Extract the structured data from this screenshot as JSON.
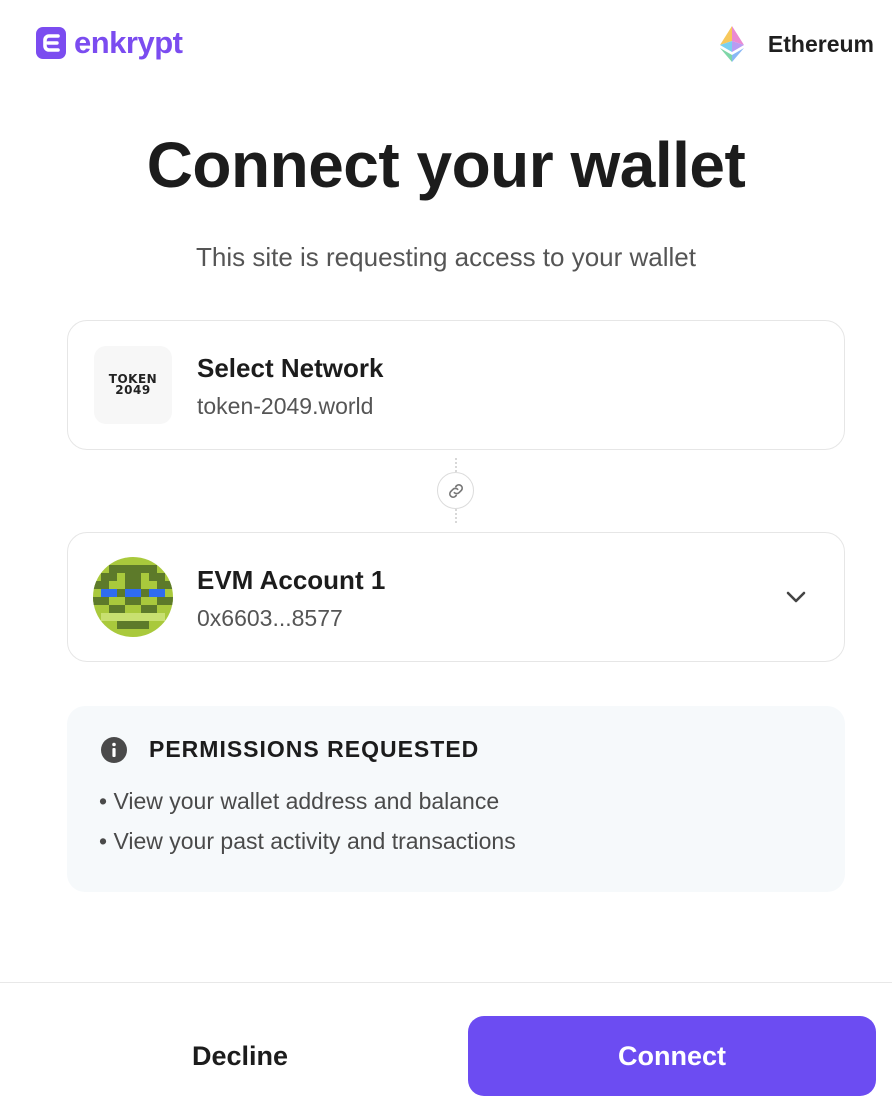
{
  "header": {
    "brand_name": "enkrypt",
    "brand_icon": "enkrypt-logo",
    "network_icon": "ethereum-icon",
    "network_name": "Ethereum"
  },
  "main": {
    "title": "Connect your wallet",
    "subtitle": "This site is requesting access to your wallet"
  },
  "site": {
    "logo_text_line1": "TOKEN",
    "logo_text_line2": "2049",
    "title": "Select Network",
    "domain": "token-2049.world"
  },
  "connector": {
    "icon": "link-icon"
  },
  "account": {
    "name": "EVM Account 1",
    "address": "0x6603...8577",
    "avatar_icon": "identicon-avatar",
    "dropdown_icon": "chevron-down-icon"
  },
  "permissions": {
    "icon": "info-icon",
    "title": "PERMISSIONS REQUESTED",
    "items": [
      "• View your wallet address and balance",
      "• View your past activity and transactions"
    ]
  },
  "footer": {
    "decline_label": "Decline",
    "connect_label": "Connect"
  },
  "colors": {
    "brand": "#7b4cf0",
    "primary_button": "#6c4cf2",
    "permissions_bg": "#f6f9fb"
  }
}
